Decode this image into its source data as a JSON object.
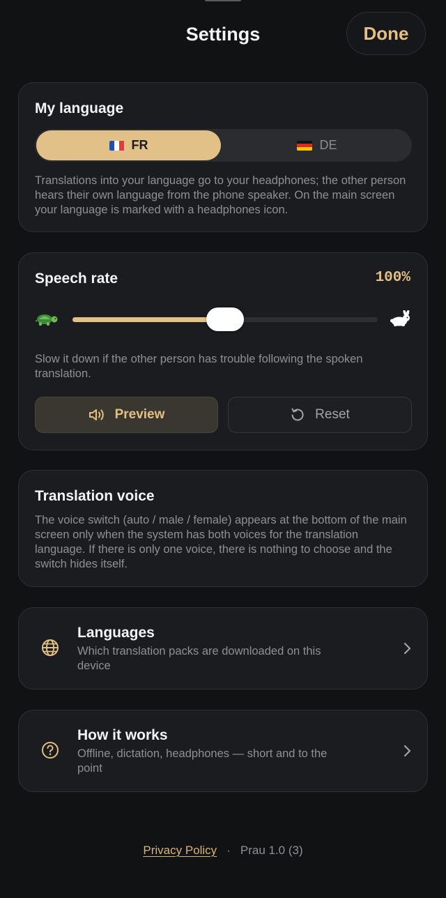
{
  "header": {
    "title": "Settings",
    "done_label": "Done"
  },
  "my_language": {
    "title": "My language",
    "options": [
      {
        "code": "FR",
        "flag": "france-flag",
        "selected": true
      },
      {
        "code": "DE",
        "flag": "germany-flag",
        "selected": false
      }
    ],
    "description": "Translations into your language go to your headphones; the other person hears their own language from the phone speaker. On the main screen your language is marked with a headphones icon."
  },
  "speech_rate": {
    "title": "Speech rate",
    "value_label": "100%",
    "slider_value": 0.5,
    "slow_icon": "turtle-icon",
    "fast_icon": "rabbit-icon",
    "description": "Slow it down if the other person has trouble following the spoken translation.",
    "preview_label": "Preview",
    "reset_label": "Reset"
  },
  "translation_voice": {
    "title": "Translation voice",
    "description": "The voice switch (auto / male / female) appears at the bottom of the main screen only when the system has both voices for the translation language. If there is only one voice, there is nothing to choose and the switch hides itself."
  },
  "nav": [
    {
      "title": "Languages",
      "subtitle": "Which translation packs are downloaded on this device",
      "icon": "globe-icon"
    },
    {
      "title": "How it works",
      "subtitle": "Offline, dictation, headphones — short and to the point",
      "icon": "question-circle-icon"
    }
  ],
  "footer": {
    "privacy_label": "Privacy Policy",
    "separator": "·",
    "version": "Prau 1.0 (3)"
  },
  "colors": {
    "accent": "#e2c189",
    "background": "#111214",
    "card": "#1b1c20"
  }
}
